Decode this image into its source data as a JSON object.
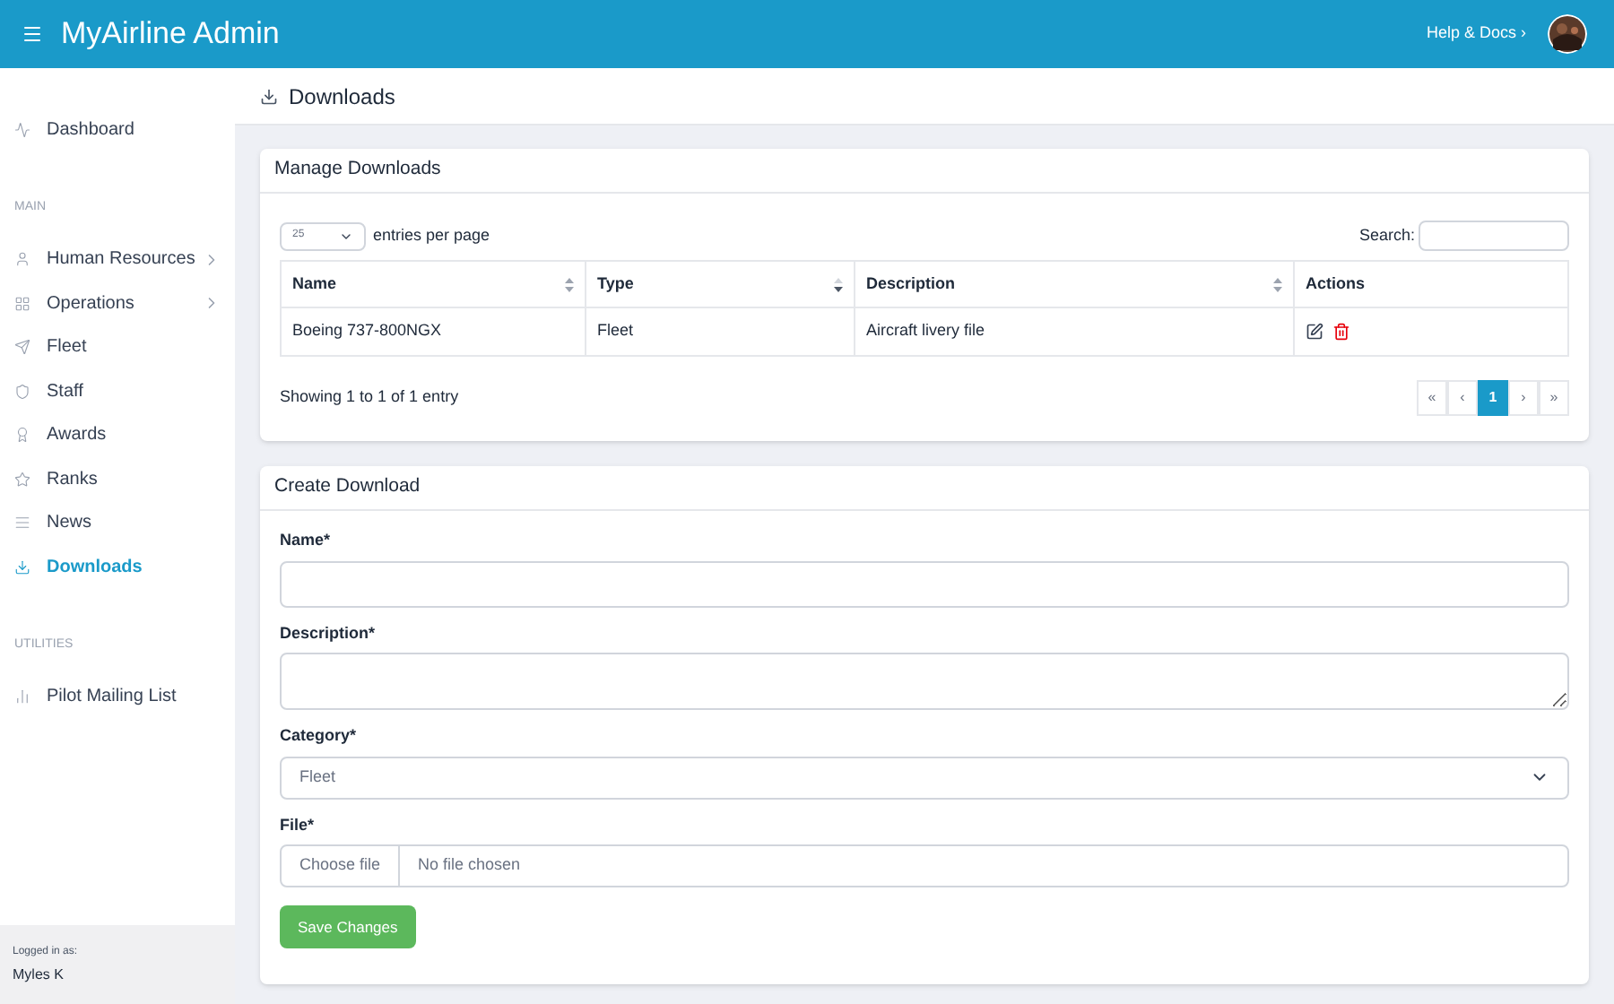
{
  "header": {
    "title": "MyAirline Admin",
    "help_link": "Help & Docs ›"
  },
  "sidebar": {
    "items": [
      {
        "label": "Dashboard",
        "kind": "item",
        "selected": false,
        "expandable": false
      },
      {
        "label": "MAIN",
        "kind": "heading"
      },
      {
        "label": "Human Resources",
        "kind": "item",
        "selected": false,
        "expandable": true
      },
      {
        "label": "Operations",
        "kind": "item",
        "selected": false,
        "expandable": true
      },
      {
        "label": "Fleet",
        "kind": "item",
        "selected": false,
        "expandable": false
      },
      {
        "label": "Staff",
        "kind": "item",
        "selected": false,
        "expandable": false
      },
      {
        "label": "Awards",
        "kind": "item",
        "selected": false,
        "expandable": false
      },
      {
        "label": "Ranks",
        "kind": "item",
        "selected": false,
        "expandable": false
      },
      {
        "label": "News",
        "kind": "item",
        "selected": false,
        "expandable": false
      },
      {
        "label": "Downloads",
        "kind": "item",
        "selected": true,
        "expandable": false
      },
      {
        "label": "UTILITIES",
        "kind": "heading"
      },
      {
        "label": "Pilot Mailing List",
        "kind": "item",
        "selected": false,
        "expandable": false
      }
    ],
    "footer": {
      "caption": "Logged in as:",
      "user": "Myles K"
    }
  },
  "page_title": "Downloads",
  "manage": {
    "title": "Manage Downloads",
    "page_size": "25",
    "page_size_label": "entries per page",
    "search_label": "Search:",
    "table": {
      "columns": [
        {
          "label": "Name",
          "sortable": true,
          "sorted": false
        },
        {
          "label": "Type",
          "sortable": true,
          "sorted": true
        },
        {
          "label": "Description",
          "sortable": true,
          "sorted": false
        },
        {
          "label": "Actions",
          "sortable": false
        }
      ],
      "rows": [
        {
          "name": "Boeing 737-800NGX",
          "type": "Fleet",
          "description": "Aircraft livery file"
        }
      ]
    },
    "summary": "Showing 1 to 1 of 1 entry",
    "pagination": [
      {
        "label": "«",
        "selected": false
      },
      {
        "label": "‹",
        "selected": false
      },
      {
        "label": "1",
        "selected": true
      },
      {
        "label": "›",
        "selected": false
      },
      {
        "label": "»",
        "selected": false
      }
    ]
  },
  "create": {
    "title": "Create Download",
    "fields": [
      {
        "label": "Name*",
        "kind": "text"
      },
      {
        "label": "Description*",
        "kind": "textarea"
      },
      {
        "label": "Category*",
        "kind": "select",
        "value": "Fleet"
      },
      {
        "label": "File*",
        "kind": "file",
        "button": "Choose file",
        "value": "No file chosen"
      }
    ],
    "submit": "Save Changes"
  }
}
